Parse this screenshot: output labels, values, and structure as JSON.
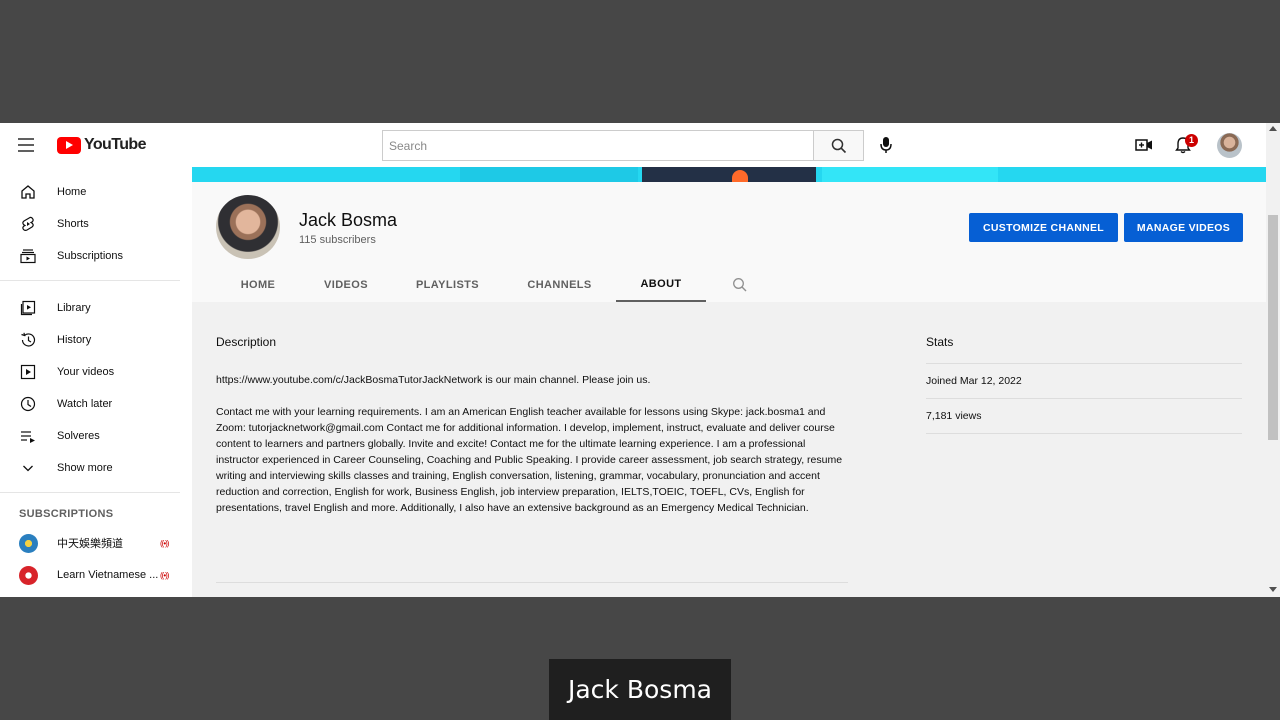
{
  "masthead": {
    "logo_text": "YouTube",
    "search_placeholder": "Search",
    "notification_count": "1"
  },
  "sidebar": {
    "items": [
      {
        "label": "Home",
        "icon": "home-icon"
      },
      {
        "label": "Shorts",
        "icon": "shorts-icon"
      },
      {
        "label": "Subscriptions",
        "icon": "subscriptions-icon"
      },
      {
        "label": "Library",
        "icon": "library-icon"
      },
      {
        "label": "History",
        "icon": "history-icon"
      },
      {
        "label": "Your videos",
        "icon": "your-videos-icon"
      },
      {
        "label": "Watch later",
        "icon": "watch-later-icon"
      },
      {
        "label": "Solveres",
        "icon": "playlist-icon"
      },
      {
        "label": "Show more",
        "icon": "chevron-down-icon"
      }
    ],
    "subscriptions_heading": "SUBSCRIPTIONS",
    "subscriptions": [
      {
        "name": "中天娛樂頻道",
        "live": true,
        "color": "#2a7fbf"
      },
      {
        "name": "Learn Vietnamese ...",
        "live": true,
        "color": "#d8232a"
      }
    ]
  },
  "channel": {
    "name": "Jack Bosma",
    "subscribers": "115 subscribers",
    "customize_label": "CUSTOMIZE CHANNEL",
    "manage_label": "MANAGE VIDEOS",
    "tabs": [
      "HOME",
      "VIDEOS",
      "PLAYLISTS",
      "CHANNELS",
      "ABOUT"
    ],
    "active_tab": "ABOUT"
  },
  "about": {
    "description_heading": "Description",
    "paragraph1": "https://www.youtube.com/c/JackBosmaTutorJackNetwork is our main channel. Please join us.",
    "paragraph2": "Contact me with your learning requirements. I am an American English teacher available for lessons using Skype: jack.bosma1 and Zoom: tutorjacknetwork@gmail.com Contact me for additional information. I develop, implement, instruct, evaluate and deliver course content to learners and partners globally. Invite and excite! Contact me for the ultimate learning experience. I am a professional instructor experienced in Career Counseling, Coaching and Public Speaking. I provide career assessment, job search strategy, resume writing and interviewing skills classes and training, English conversation, listening, grammar, vocabulary, pronunciation and accent reduction and correction, English for work, Business English, job interview preparation, IELTS,TOEIC, TOEFL, CVs, English for presentations, travel English and more. Additionally, I also have an extensive background as an Emergency Medical Technician.",
    "stats_heading": "Stats",
    "joined": "Joined Mar 12, 2022",
    "views": "7,181 views"
  },
  "caption": "Jack Bosma",
  "colors": {
    "accent_blue": "#065fd4",
    "brand_red": "#ff0000",
    "live_red": "#cc0000"
  }
}
